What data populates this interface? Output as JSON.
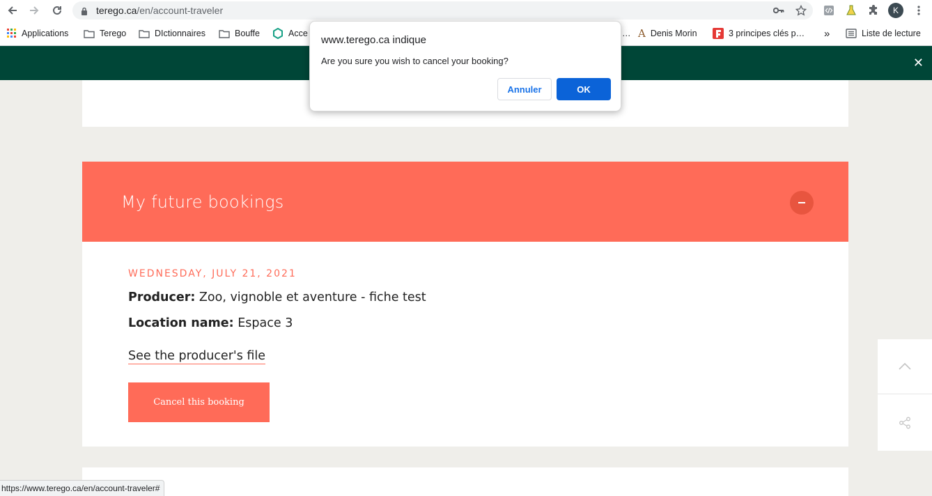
{
  "browser": {
    "url_host": "terego.ca",
    "url_path": "/en/account-traveler",
    "avatar_letter": "K"
  },
  "bookmarks": [
    {
      "label": "Applications",
      "icon": "apps-grid-icon"
    },
    {
      "label": "Terego",
      "icon": "folder-icon"
    },
    {
      "label": "DIctionnaires",
      "icon": "folder-icon"
    },
    {
      "label": "Bouffe",
      "icon": "folder-icon"
    },
    {
      "label": "Acce",
      "icon": "hexagon-icon"
    },
    {
      "label": "…",
      "icon": ""
    },
    {
      "label": "Denis Morin",
      "icon": "a-letter-icon"
    },
    {
      "label": "3 principes clés p…",
      "icon": "red-f-icon"
    },
    {
      "label": "»",
      "icon": ""
    },
    {
      "label": "Liste de lecture",
      "icon": "reading-list-icon"
    }
  ],
  "banner": {
    "close_glyph": "✕",
    "color": "#004637"
  },
  "section": {
    "title": "My future bookings",
    "color": "#ff6b58"
  },
  "booking": {
    "date": "WEDNESDAY, JULY 21, 2021",
    "producer_label": "Producer:",
    "producer_value": "Zoo, vignoble et aventure - fiche test",
    "location_label": "Location name:",
    "location_value": "Espace 3",
    "producer_link": "See the producer's file",
    "cancel_button": "Cancel this booking"
  },
  "dialog": {
    "title": "www.terego.ca indique",
    "message": "Are you sure you wish to cancel your booking?",
    "cancel_label": "Annuler",
    "ok_label": "OK"
  },
  "statusbar": {
    "url": "https://www.terego.ca/en/account-traveler#"
  }
}
